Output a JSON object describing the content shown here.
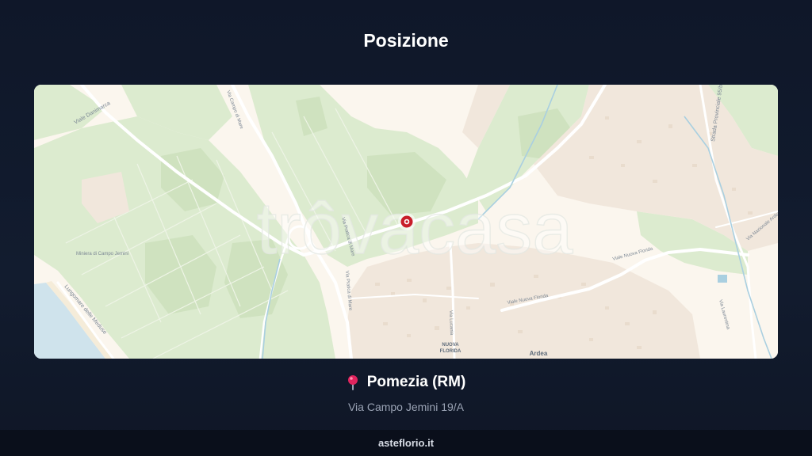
{
  "header": {
    "title": "Posizione"
  },
  "map": {
    "watermark": "trôvacasa",
    "labels": {
      "viale_danimarca": "Viale Danimarca",
      "strada_provinciale": "Strada Provinciale 95/b",
      "miniera": "Miniera di Campo Jemini",
      "lungomare": "Lungomare delle Meduse",
      "via_nuova_florida_1": "Viale Nuova Florida",
      "via_nuova_florida_2": "Viale Nuova Florida",
      "via_lavinium": "Via Laurentina",
      "via_nazionale": "Via Nazionale Ardeatina",
      "via_campo_di_mare": "Via Campo di Mare",
      "via_pratica": "Via Pratica di Mare",
      "via_lucania": "Via Lucania",
      "nuova_florida_1": "NUOVA",
      "nuova_florida_2": "FLORIDA",
      "ardea": "Ardea"
    },
    "marker_icon": "map-pin-marker-icon"
  },
  "location": {
    "pin_icon": "location-pin-icon",
    "city": "Pomezia (RM)",
    "address": "Via Campo Jemini 19/A"
  },
  "footer": {
    "site": "asteflorio.it"
  }
}
